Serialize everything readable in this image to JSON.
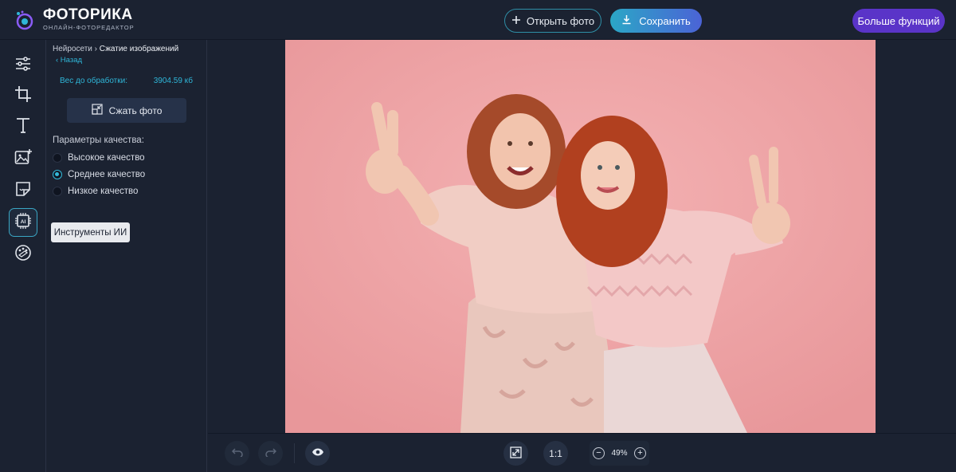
{
  "app": {
    "logo_title": "ФОТОРИКА",
    "logo_subtitle": "ОНЛАЙН-ФОТОРЕДАКТОР"
  },
  "header": {
    "open_label": "Открыть фото",
    "save_label": "Сохранить",
    "more_label": "Больше функций"
  },
  "rail": {
    "items": [
      {
        "icon": "sliders-icon"
      },
      {
        "icon": "crop-icon"
      },
      {
        "icon": "text-icon"
      },
      {
        "icon": "image-add-icon"
      },
      {
        "icon": "sticker-icon"
      },
      {
        "icon": "ai-chip-icon",
        "active": true
      },
      {
        "icon": "palette-icon"
      }
    ],
    "tooltip": "Инструменты ИИ"
  },
  "panel": {
    "breadcrumb_parent": "Нейросети",
    "breadcrumb_sep": "›",
    "breadcrumb_current": "Сжатие изображений",
    "back_label": "‹ Назад",
    "weight_label": "Вес до обработки:",
    "weight_value": "3904.59 кб",
    "compress_label": "Сжать фото",
    "quality_title": "Параметры качества:",
    "quality_options": [
      {
        "label": "Высокое качество",
        "checked": false
      },
      {
        "label": "Среднее качество",
        "checked": true
      },
      {
        "label": "Низкое качество",
        "checked": false
      }
    ]
  },
  "bottom": {
    "one_to_one": "1:1",
    "zoom_value": "49%",
    "zoom_minus": "−",
    "zoom_plus": "+"
  },
  "colors": {
    "background": "#1b2231",
    "accent": "#2fb6d8",
    "purple": "#5a34c8",
    "photo_bg": "#f0a5a7"
  }
}
